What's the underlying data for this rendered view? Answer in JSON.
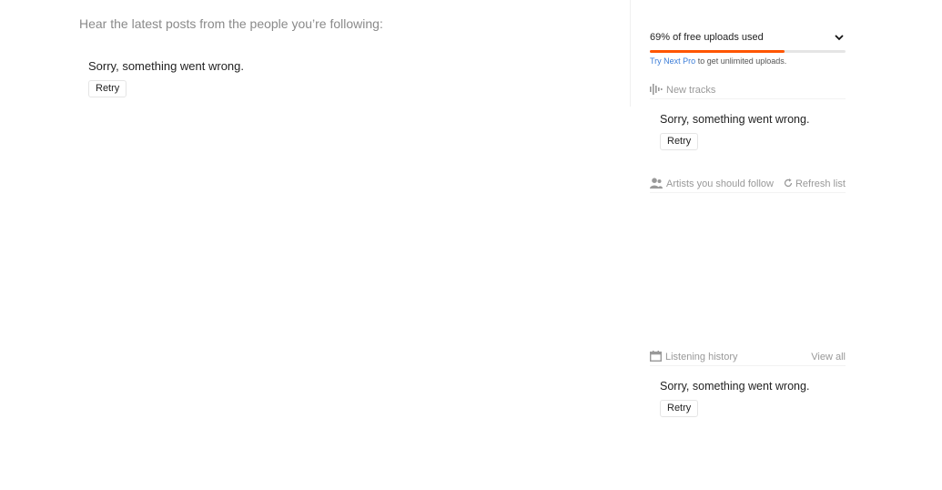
{
  "stream": {
    "heading": "Hear the latest posts from the people you’re following:",
    "error_text": "Sorry, something went wrong.",
    "retry_label": "Retry"
  },
  "sidebar": {
    "uploads": {
      "label": "69% of free uploads used",
      "percent_used": 69,
      "upsell_link": "Try Next Pro",
      "upsell_text": " to get unlimited uploads."
    },
    "new_tracks": {
      "title": "New tracks",
      "icon": "waveform-icon",
      "error_text": "Sorry, something went wrong.",
      "retry_label": "Retry"
    },
    "artists": {
      "title": "Artists you should follow",
      "icon": "users-icon",
      "action_label": "Refresh list",
      "action_icon": "refresh-icon"
    },
    "history": {
      "title": "Listening history",
      "icon": "calendar-icon",
      "action_label": "View all",
      "error_text": "Sorry, something went wrong.",
      "retry_label": "Retry"
    }
  },
  "colors": {
    "accent": "#ff5500",
    "link": "#3b7dd8",
    "muted": "#999999"
  }
}
